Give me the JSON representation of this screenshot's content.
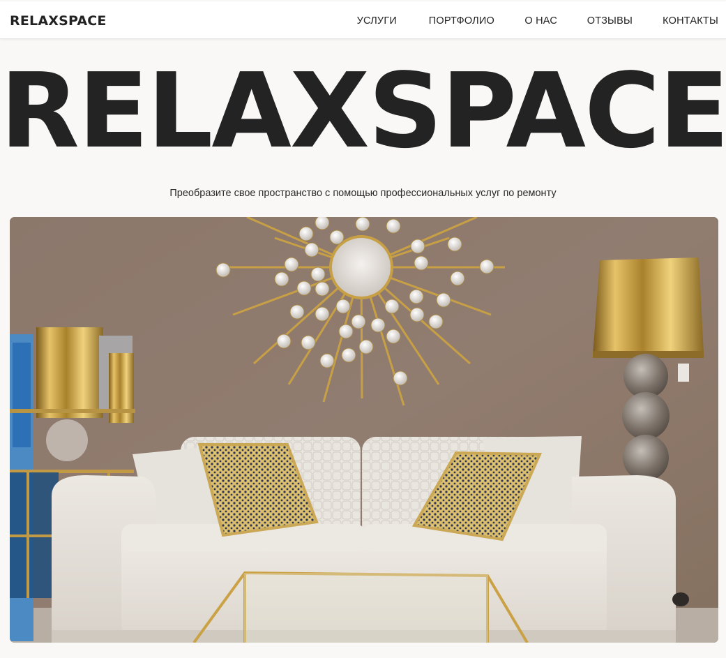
{
  "header": {
    "brand": "RELAXSPACE",
    "nav": [
      {
        "label": "УСЛУГИ"
      },
      {
        "label": "ПОРТФОЛИО"
      },
      {
        "label": "О НАС"
      },
      {
        "label": "ОТЗЫВЫ"
      },
      {
        "label": "КОНТАКТЫ"
      }
    ]
  },
  "hero": {
    "title": "RELAXSPACE",
    "subtitle": "Преобразите свое пространство с помощью профессиональных услуг по ремонту",
    "image": {
      "subject": "living-room-photo",
      "elements": [
        "sunburst-mirror",
        "sofa",
        "gold-lamp",
        "cushions",
        "glass-coffee-table",
        "gold-shelf"
      ]
    }
  },
  "colors": {
    "background": "#f9f8f6",
    "text": "#222222",
    "wall": "#8e7a6e",
    "gold": "#c9a245",
    "sofa": "#e6e1da"
  }
}
